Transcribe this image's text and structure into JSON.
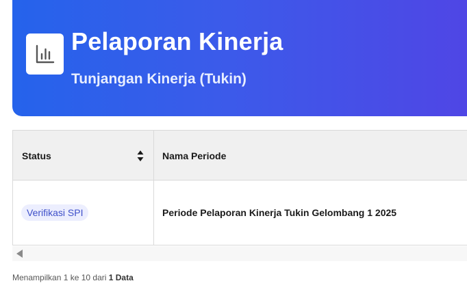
{
  "header": {
    "title": "Pelaporan Kinerja",
    "subtitle": "Tunjangan Kinerja (Tukin)",
    "icon": "bar-chart-icon",
    "gradient_start": "#2563eb",
    "gradient_end": "#4f46e5"
  },
  "table": {
    "columns": [
      "Status",
      "Nama Periode"
    ],
    "rows": [
      {
        "status": "Verifikasi SPI",
        "nama_periode": "Periode Pelaporan Kinerja Tukin Gelombang 1 2025"
      }
    ]
  },
  "footer": {
    "prefix": "Menampilkan 1 ke 10 dari ",
    "total": "1 Data"
  }
}
